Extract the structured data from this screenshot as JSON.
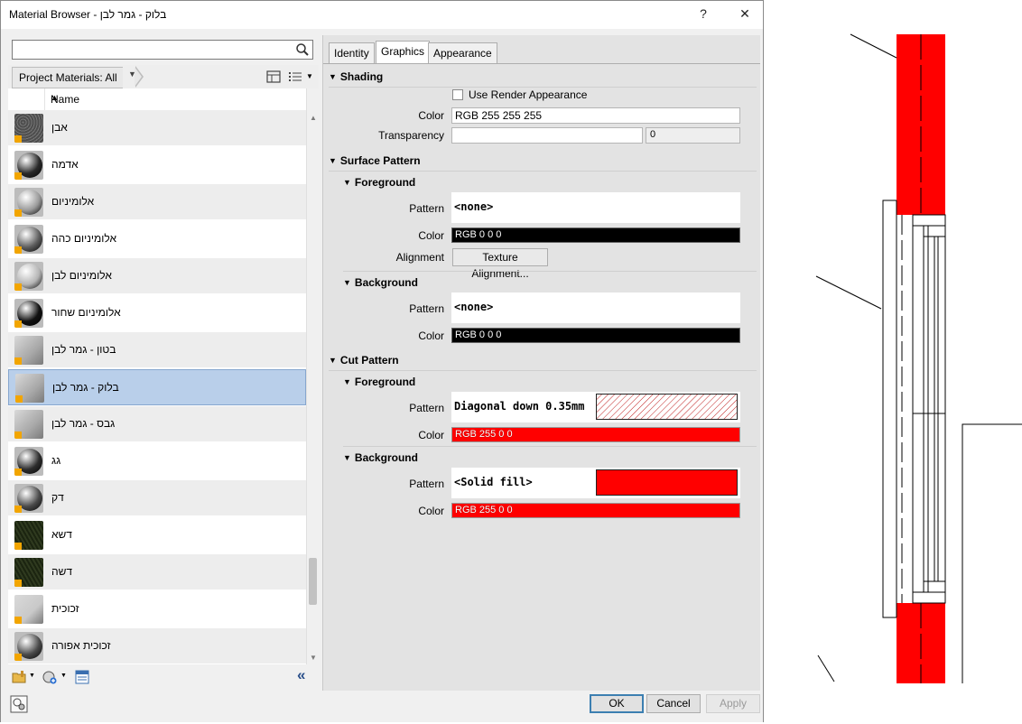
{
  "window": {
    "title": "Material Browser - בלוק - גמר לבן",
    "help_label": "?",
    "close_label": "✕"
  },
  "search": {
    "value": "",
    "placeholder": ""
  },
  "breadcrumb": {
    "label": "Project Materials: All"
  },
  "list_header": {
    "name": "Name"
  },
  "materials": [
    {
      "label": "אבן",
      "thumb": "#6b6b6b",
      "style": "rough"
    },
    {
      "label": "אדמה",
      "thumb": "#2a2a2a",
      "style": "ball-dark"
    },
    {
      "label": "אלומיניום",
      "thumb": "#9a9a9a",
      "style": "ball-light"
    },
    {
      "label": "אלומיניום כהה",
      "thumb": "#5d5d5d",
      "style": "ball-dark"
    },
    {
      "label": "אלומיניום לבן",
      "thumb": "#b5b5b5",
      "style": "ball-light"
    },
    {
      "label": "אלומיניום שחור",
      "thumb": "#111111",
      "style": "ball-dark"
    },
    {
      "label": "בטון - גמר לבן",
      "thumb": "#a8a8a8",
      "style": "block"
    },
    {
      "label": "בלוק - גמר לבן",
      "thumb": "#a8a8a8",
      "style": "block",
      "selected": true
    },
    {
      "label": "גבס - גמר לבן",
      "thumb": "#a8a8a8",
      "style": "block"
    },
    {
      "label": "גג",
      "thumb": "#2d2d2d",
      "style": "ball-dark"
    },
    {
      "label": "דק",
      "thumb": "#4a4a4a",
      "style": "ball-dark"
    },
    {
      "label": "דשא",
      "thumb": "#2f3a1f",
      "style": "grass"
    },
    {
      "label": "דשה",
      "thumb": "#2f3a1f",
      "style": "grass"
    },
    {
      "label": "זכוכית",
      "thumb": "#c9c9c9",
      "style": "block"
    },
    {
      "label": "זכוכית אפורה",
      "thumb": "#4a4a4a",
      "style": "ball-dark"
    }
  ],
  "tabs": [
    {
      "label": "Identity",
      "active": false
    },
    {
      "label": "Graphics",
      "active": true
    },
    {
      "label": "Appearance",
      "active": false
    }
  ],
  "shading": {
    "title": "Shading",
    "use_render_label": "Use Render Appearance",
    "use_render_checked": false,
    "color_label": "Color",
    "color_value": "RGB 255 255 255",
    "transparency_label": "Transparency",
    "transparency_value": "0"
  },
  "surface_pattern": {
    "title": "Surface Pattern",
    "foreground": {
      "title": "Foreground",
      "pattern_label": "Pattern",
      "pattern_value": "<none>",
      "color_label": "Color",
      "color_value": "RGB 0 0 0",
      "color": "#000000",
      "alignment_label": "Alignment",
      "alignment_button": "Texture Alignment..."
    },
    "background": {
      "title": "Background",
      "pattern_label": "Pattern",
      "pattern_value": "<none>",
      "color_label": "Color",
      "color_value": "RGB 0 0 0",
      "color": "#000000"
    }
  },
  "cut_pattern": {
    "title": "Cut Pattern",
    "foreground": {
      "title": "Foreground",
      "pattern_label": "Pattern",
      "pattern_value": "Diagonal down 0.35mm",
      "color_label": "Color",
      "color_value": "RGB 255 0 0",
      "color": "#ff0000"
    },
    "background": {
      "title": "Background",
      "pattern_label": "Pattern",
      "pattern_value": "<Solid fill>",
      "color_label": "Color",
      "color_value": "RGB 255 0 0",
      "color": "#ff0000"
    }
  },
  "buttons": {
    "ok": "OK",
    "cancel": "Cancel",
    "apply": "Apply"
  },
  "icons": {
    "search": "magnifier-icon",
    "tile_view": "tile-view-icon",
    "list_view": "list-view-icon",
    "open_library": "folder-library-icon",
    "create_material": "globe-add-icon",
    "asset_browser": "asset-browser-icon",
    "collapse": "double-chevron-left-icon",
    "material_editor": "material-editor-icon"
  }
}
